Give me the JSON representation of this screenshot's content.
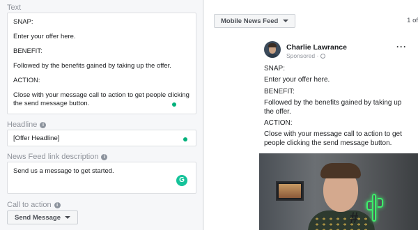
{
  "editor": {
    "text_label": "Text",
    "text_lines": [
      "SNAP:",
      "Enter your offer here.",
      "BENEFIT:",
      "Followed by the benefits gained by taking up the offer.",
      "ACTION:",
      "Close with your message call to action to get people clicking the send message button."
    ],
    "headline_label": "Headline",
    "headline_value": "[Offer Headline]",
    "description_label": "News Feed link description",
    "description_value": "Send us a message to get started.",
    "cta_label": "Call to action",
    "cta_value": "Send Message",
    "info_icon": "i",
    "grammarly_icon": "G"
  },
  "preview": {
    "placement": "Mobile News Feed",
    "page_count": "1 of",
    "author": "Charlie Lawrance",
    "sponsored": "Sponsored ·",
    "more_icon": "···",
    "post_lines": [
      "SNAP:",
      "Enter your offer here.",
      "BENEFIT:",
      "Followed by the benefits gained by taking up the offer.",
      "ACTION:",
      "Close with your message call to action to get people clicking the send message button."
    ],
    "hashtag_decor": "#"
  },
  "colors": {
    "grammarly_green": "#15c39a",
    "status_dot": "#00b17b",
    "neon_cactus": "#3df06b"
  }
}
